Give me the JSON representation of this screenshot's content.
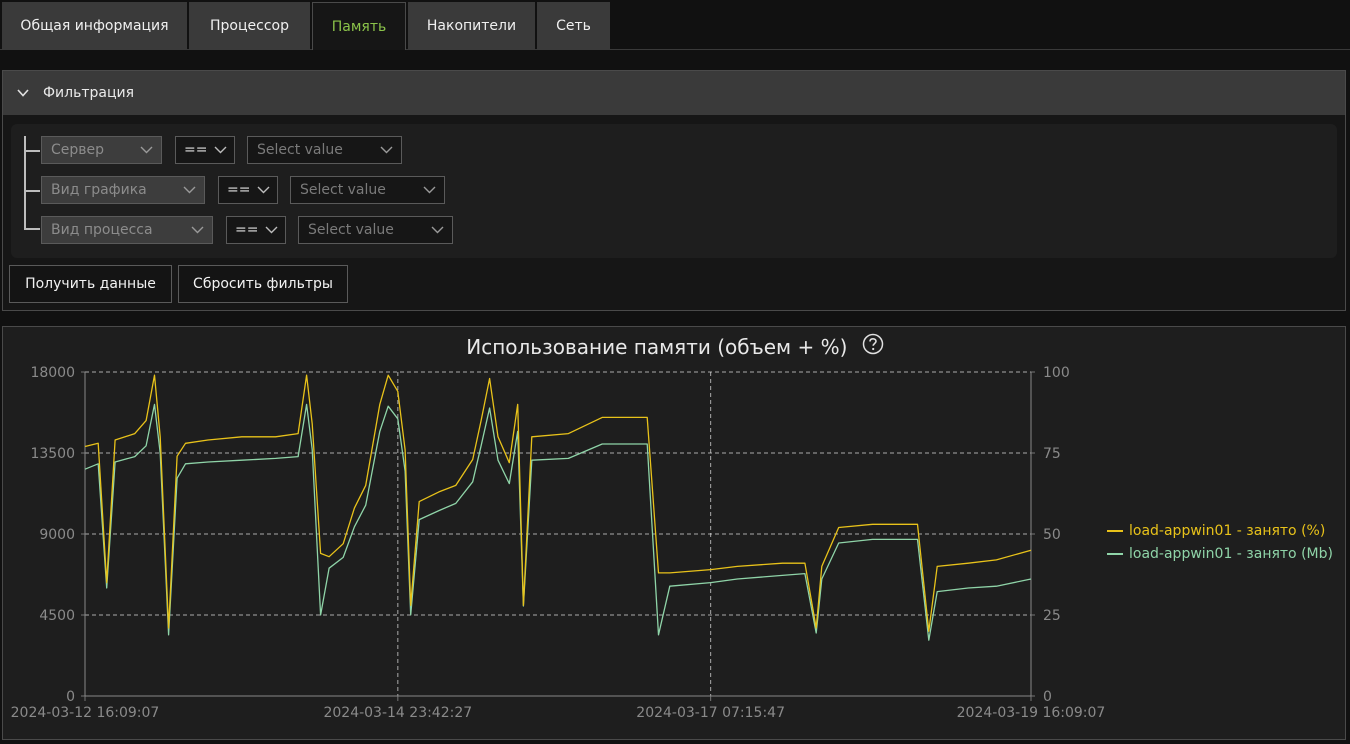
{
  "tabs": [
    {
      "label": "Общая информация",
      "active": false
    },
    {
      "label": "Процессор",
      "active": false
    },
    {
      "label": "Память",
      "active": true
    },
    {
      "label": "Накопители",
      "active": false
    },
    {
      "label": "Сеть",
      "active": false
    }
  ],
  "filter": {
    "title": "Фильтрация",
    "rows": [
      {
        "field": "Сервер",
        "operator": "==",
        "value_placeholder": "Select value"
      },
      {
        "field": "Вид графика",
        "operator": "==",
        "value_placeholder": "Select value"
      },
      {
        "field": "Вид процесса",
        "operator": "==",
        "value_placeholder": "Select value"
      }
    ],
    "get_data_label": "Получить данные",
    "reset_label": "Сбросить фильтры"
  },
  "colors": {
    "accent": "#8bc34a",
    "series_pct": "#e8c21a",
    "series_mb": "#8fd4a8",
    "grid": "#d9d9d9",
    "axis_text": "#8a8a8a"
  },
  "chart_data": {
    "type": "line",
    "title": "Использование памяти (объем + %)",
    "xlabel": "",
    "ylabel": "",
    "ylim": [
      0,
      18000
    ],
    "y2lim": [
      0,
      100
    ],
    "y_ticks": [
      "18000",
      "13500",
      "9000",
      "4500",
      "0"
    ],
    "y2_ticks": [
      "100",
      "75",
      "50",
      "25",
      "0"
    ],
    "x_ticks": [
      "2024-03-12 16:09:07",
      "2024-03-14 23:42:27",
      "2024-03-17 07:15:47",
      "2024-03-19 16:09:07"
    ],
    "x_range": [
      "2024-03-12 16:09:07",
      "2024-03-19 16:09:07"
    ],
    "grid": true,
    "legend_position": "right",
    "series": [
      {
        "name": "load-appwin01 - занято (%)",
        "axis": "right",
        "points": [
          [
            "2024-03-12 16:09:07",
            77
          ],
          [
            "2024-03-12 18:30:00",
            78
          ],
          [
            "2024-03-12 20:00:00",
            35
          ],
          [
            "2024-03-12 21:30:00",
            79
          ],
          [
            "2024-03-13 01:00:00",
            81
          ],
          [
            "2024-03-13 03:00:00",
            85
          ],
          [
            "2024-03-13 04:30:00",
            99
          ],
          [
            "2024-03-13 05:30:00",
            80
          ],
          [
            "2024-03-13 07:00:00",
            21
          ],
          [
            "2024-03-13 08:30:00",
            74
          ],
          [
            "2024-03-13 10:00:00",
            78
          ],
          [
            "2024-03-13 14:00:00",
            79
          ],
          [
            "2024-03-13 20:00:00",
            80
          ],
          [
            "2024-03-14 02:00:00",
            80
          ],
          [
            "2024-03-14 06:00:00",
            81
          ],
          [
            "2024-03-14 07:30:00",
            99
          ],
          [
            "2024-03-14 08:30:00",
            84
          ],
          [
            "2024-03-14 10:00:00",
            44
          ],
          [
            "2024-03-14 11:30:00",
            43
          ],
          [
            "2024-03-14 14:00:00",
            47
          ],
          [
            "2024-03-14 16:00:00",
            58
          ],
          [
            "2024-03-14 18:00:00",
            65
          ],
          [
            "2024-03-14 20:30:00",
            90
          ],
          [
            "2024-03-14 22:00:00",
            99
          ],
          [
            "2024-03-14 23:42:27",
            94
          ],
          [
            "2024-03-15 01:00:00",
            76
          ],
          [
            "2024-03-15 02:00:00",
            28
          ],
          [
            "2024-03-15 03:30:00",
            60
          ],
          [
            "2024-03-15 07:00:00",
            63
          ],
          [
            "2024-03-15 10:00:00",
            65
          ],
          [
            "2024-03-15 13:00:00",
            73
          ],
          [
            "2024-03-15 14:30:00",
            85
          ],
          [
            "2024-03-15 16:00:00",
            98
          ],
          [
            "2024-03-15 17:30:00",
            80
          ],
          [
            "2024-03-15 19:30:00",
            72
          ],
          [
            "2024-03-15 21:00:00",
            90
          ],
          [
            "2024-03-15 22:00:00",
            28
          ],
          [
            "2024-03-15 23:30:00",
            80
          ],
          [
            "2024-03-16 06:00:00",
            81
          ],
          [
            "2024-03-16 12:00:00",
            86
          ],
          [
            "2024-03-16 20:00:00",
            86
          ],
          [
            "2024-03-16 22:00:00",
            38
          ],
          [
            "2024-03-17 00:00:00",
            38
          ],
          [
            "2024-03-17 07:15:47",
            39
          ],
          [
            "2024-03-17 12:00:00",
            40
          ],
          [
            "2024-03-17 20:00:00",
            41
          ],
          [
            "2024-03-18 00:00:00",
            41
          ],
          [
            "2024-03-18 02:00:00",
            21
          ],
          [
            "2024-03-18 03:00:00",
            40
          ],
          [
            "2024-03-18 06:00:00",
            52
          ],
          [
            "2024-03-18 12:00:00",
            53
          ],
          [
            "2024-03-18 20:00:00",
            53
          ],
          [
            "2024-03-18 22:00:00",
            20
          ],
          [
            "2024-03-18 23:30:00",
            40
          ],
          [
            "2024-03-19 05:00:00",
            41
          ],
          [
            "2024-03-19 10:00:00",
            42
          ],
          [
            "2024-03-19 16:09:07",
            45
          ]
        ]
      },
      {
        "name": "load-appwin01 - занято (Mb)",
        "axis": "left",
        "points": [
          [
            "2024-03-12 16:09:07",
            12600
          ],
          [
            "2024-03-12 18:30:00",
            12900
          ],
          [
            "2024-03-12 20:00:00",
            6000
          ],
          [
            "2024-03-12 21:30:00",
            13000
          ],
          [
            "2024-03-13 01:00:00",
            13300
          ],
          [
            "2024-03-13 03:00:00",
            13900
          ],
          [
            "2024-03-13 04:30:00",
            16200
          ],
          [
            "2024-03-13 05:30:00",
            13500
          ],
          [
            "2024-03-13 07:00:00",
            3400
          ],
          [
            "2024-03-13 08:30:00",
            12100
          ],
          [
            "2024-03-13 10:00:00",
            12900
          ],
          [
            "2024-03-13 14:00:00",
            13000
          ],
          [
            "2024-03-13 20:00:00",
            13100
          ],
          [
            "2024-03-14 02:00:00",
            13200
          ],
          [
            "2024-03-14 06:00:00",
            13300
          ],
          [
            "2024-03-14 07:30:00",
            16200
          ],
          [
            "2024-03-14 08:30:00",
            13700
          ],
          [
            "2024-03-14 10:00:00",
            4500
          ],
          [
            "2024-03-14 11:30:00",
            7100
          ],
          [
            "2024-03-14 14:00:00",
            7700
          ],
          [
            "2024-03-14 16:00:00",
            9400
          ],
          [
            "2024-03-14 18:00:00",
            10600
          ],
          [
            "2024-03-14 20:30:00",
            14700
          ],
          [
            "2024-03-14 22:00:00",
            16100
          ],
          [
            "2024-03-14 23:42:27",
            15400
          ],
          [
            "2024-03-15 01:00:00",
            12500
          ],
          [
            "2024-03-15 02:00:00",
            4500
          ],
          [
            "2024-03-15 03:30:00",
            9800
          ],
          [
            "2024-03-15 07:00:00",
            10300
          ],
          [
            "2024-03-15 10:00:00",
            10700
          ],
          [
            "2024-03-15 13:00:00",
            11900
          ],
          [
            "2024-03-15 14:30:00",
            13900
          ],
          [
            "2024-03-15 16:00:00",
            16000
          ],
          [
            "2024-03-15 17:30:00",
            13100
          ],
          [
            "2024-03-15 19:30:00",
            11800
          ],
          [
            "2024-03-15 21:00:00",
            14700
          ],
          [
            "2024-03-15 22:00:00",
            5000
          ],
          [
            "2024-03-15 23:30:00",
            13100
          ],
          [
            "2024-03-16 06:00:00",
            13200
          ],
          [
            "2024-03-16 12:00:00",
            14000
          ],
          [
            "2024-03-16 20:00:00",
            14000
          ],
          [
            "2024-03-16 22:00:00",
            3400
          ],
          [
            "2024-03-17 00:00:00",
            6100
          ],
          [
            "2024-03-17 07:15:47",
            6300
          ],
          [
            "2024-03-17 12:00:00",
            6500
          ],
          [
            "2024-03-17 20:00:00",
            6700
          ],
          [
            "2024-03-18 00:00:00",
            6800
          ],
          [
            "2024-03-18 02:00:00",
            3500
          ],
          [
            "2024-03-18 03:00:00",
            6500
          ],
          [
            "2024-03-18 06:00:00",
            8500
          ],
          [
            "2024-03-18 12:00:00",
            8700
          ],
          [
            "2024-03-18 20:00:00",
            8700
          ],
          [
            "2024-03-18 22:00:00",
            3100
          ],
          [
            "2024-03-18 23:30:00",
            5800
          ],
          [
            "2024-03-19 05:00:00",
            6000
          ],
          [
            "2024-03-19 10:00:00",
            6100
          ],
          [
            "2024-03-19 16:09:07",
            6500
          ]
        ]
      }
    ]
  }
}
